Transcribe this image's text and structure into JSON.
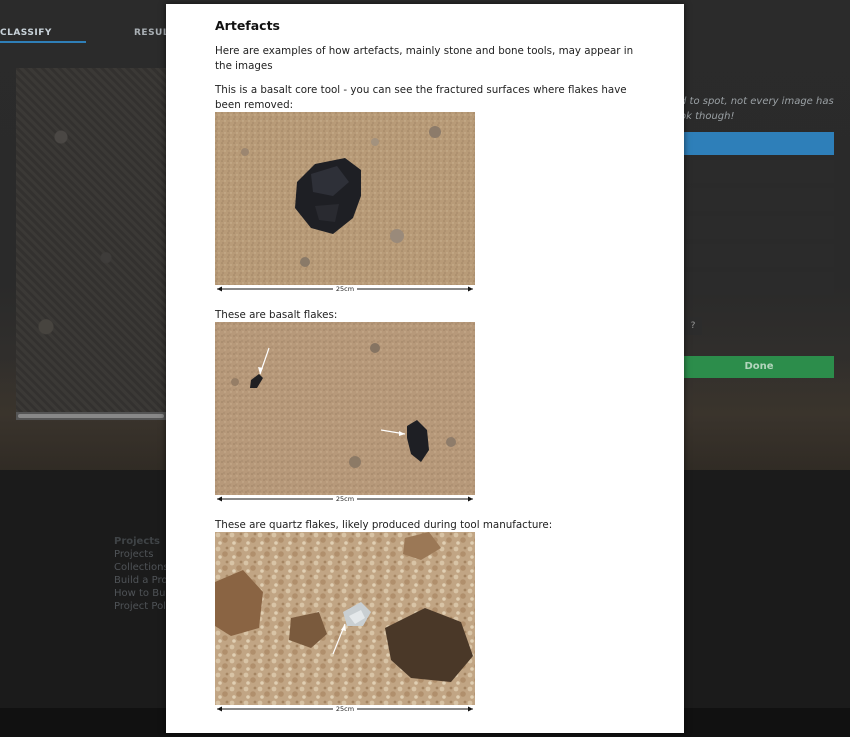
{
  "tabs": {
    "classify": "CLASSIFY",
    "result": "RESULT"
  },
  "task": {
    "hint_text": "d to spot, not every image has ok though!",
    "small_button": "?",
    "done_label": "Done"
  },
  "footer": {
    "heading": "Projects",
    "links": [
      "Projects",
      "Collections",
      "Build a Proje",
      "How to Build",
      "Project Polic"
    ]
  },
  "modal": {
    "title": "Artefacts",
    "intro": "Here are examples of how artefacts, mainly stone and bone tools, may appear in the images",
    "core_caption": "This is a basalt core tool - you can see the fractured surfaces where flakes have been removed:",
    "flakes_caption": "These are basalt flakes:",
    "quartz_caption": "These are quartz flakes, likely produced during tool manufacture:",
    "scale_label": "25cm"
  }
}
